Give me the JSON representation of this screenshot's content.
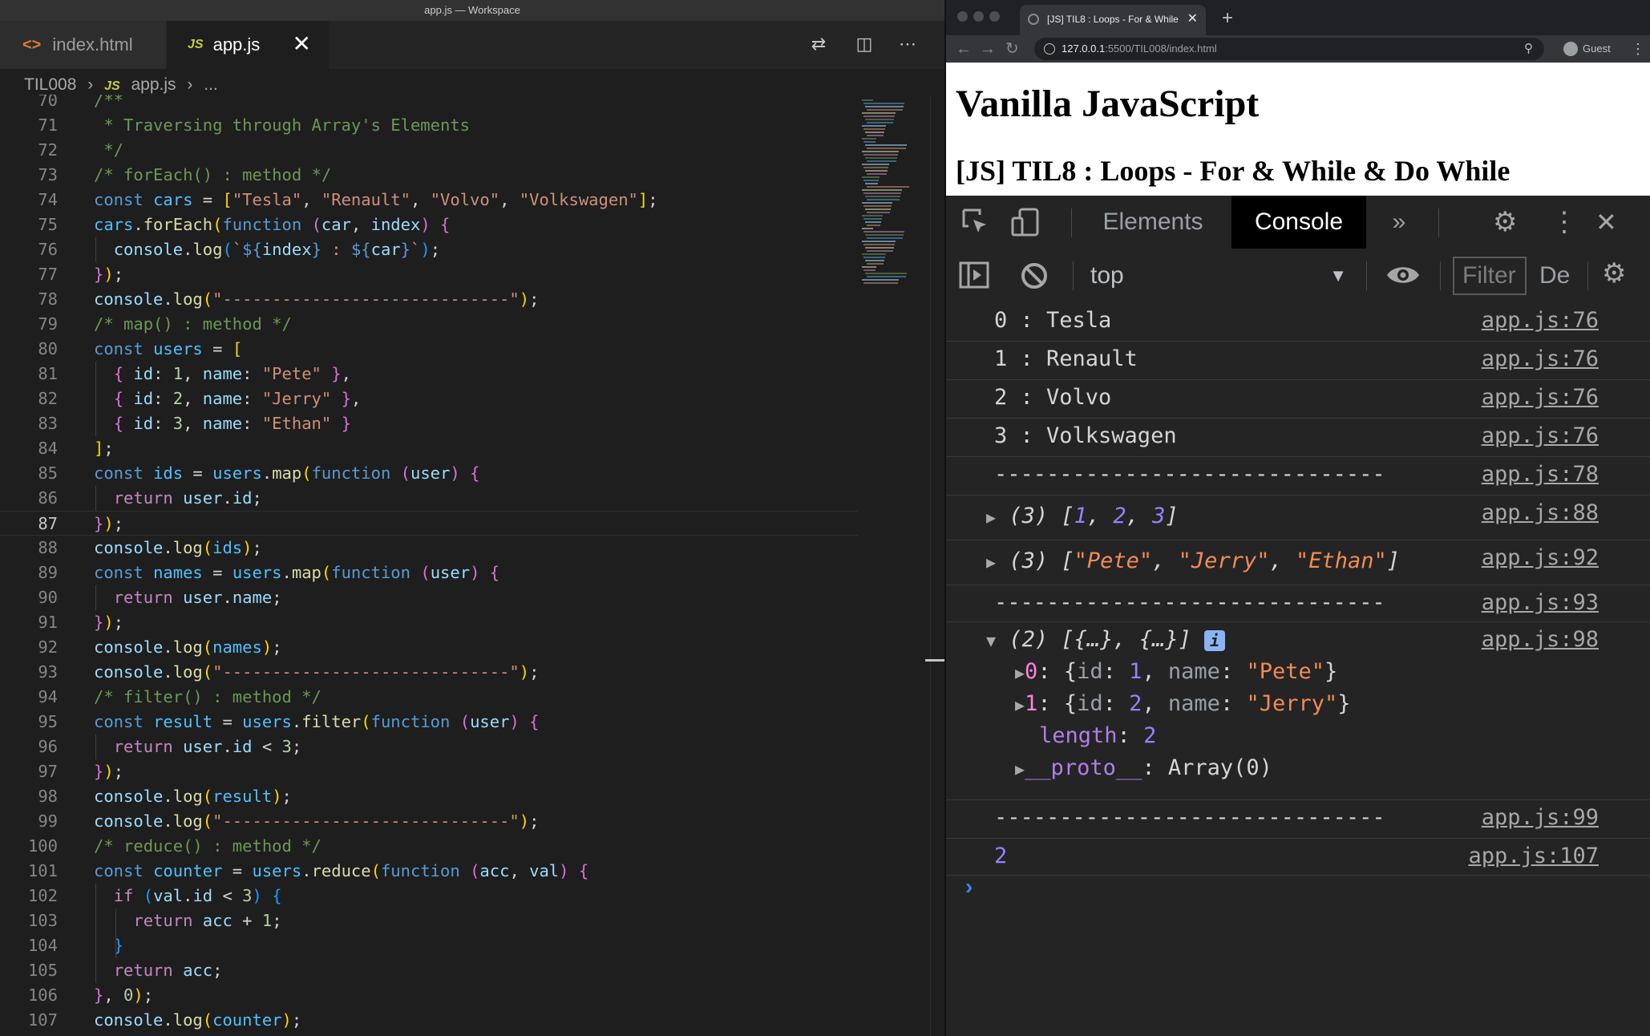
{
  "vscode": {
    "window_title": "app.js — Workspace",
    "tabs": [
      {
        "label": "index.html",
        "icon": "html-file-icon"
      },
      {
        "label": "app.js",
        "icon": "js-file-icon"
      }
    ],
    "tab_close_glyph": "✕",
    "breadcrumb": [
      "TIL008",
      "›",
      "JS",
      "app.js",
      "›",
      "..."
    ],
    "lines": [
      {
        "n": "70",
        "text": "/**"
      },
      {
        "n": "71",
        "text": " * Traversing through Array's Elements"
      },
      {
        "n": "72",
        "text": " */"
      },
      {
        "n": "73",
        "text": "/* forEach() : method */"
      },
      {
        "n": "74",
        "text": "const cars = [\"Tesla\", \"Renault\", \"Volvo\", \"Volkswagen\"];"
      },
      {
        "n": "75",
        "text": "cars.forEach(function (car, index) {"
      },
      {
        "n": "76",
        "text": "  console.log(`${index} : ${car}`);"
      },
      {
        "n": "77",
        "text": "});"
      },
      {
        "n": "78",
        "text": "console.log(\"-----------------------------\");"
      },
      {
        "n": "79",
        "text": "/* map() : method */"
      },
      {
        "n": "80",
        "text": "const users = ["
      },
      {
        "n": "81",
        "text": "  { id: 1, name: \"Pete\" },"
      },
      {
        "n": "82",
        "text": "  { id: 2, name: \"Jerry\" },"
      },
      {
        "n": "83",
        "text": "  { id: 3, name: \"Ethan\" }"
      },
      {
        "n": "84",
        "text": "];"
      },
      {
        "n": "85",
        "text": "const ids = users.map(function (user) {"
      },
      {
        "n": "86",
        "text": "  return user.id;"
      },
      {
        "n": "87",
        "text": "});"
      },
      {
        "n": "88",
        "text": "console.log(ids);"
      },
      {
        "n": "89",
        "text": "const names = users.map(function (user) {"
      },
      {
        "n": "90",
        "text": "  return user.name;"
      },
      {
        "n": "91",
        "text": "});"
      },
      {
        "n": "92",
        "text": "console.log(names);"
      },
      {
        "n": "93",
        "text": "console.log(\"-----------------------------\");"
      },
      {
        "n": "94",
        "text": "/* filter() : method */"
      },
      {
        "n": "95",
        "text": "const result = users.filter(function (user) {"
      },
      {
        "n": "96",
        "text": "  return user.id < 3;"
      },
      {
        "n": "97",
        "text": "});"
      },
      {
        "n": "98",
        "text": "console.log(result);"
      },
      {
        "n": "99",
        "text": "console.log(\"-----------------------------\");"
      },
      {
        "n": "100",
        "text": "/* reduce() : method */"
      },
      {
        "n": "101",
        "text": "const counter = users.reduce(function (acc, val) {"
      },
      {
        "n": "102",
        "text": "  if (val.id < 3) {"
      },
      {
        "n": "103",
        "text": "    return acc + 1;"
      },
      {
        "n": "104",
        "text": "  }"
      },
      {
        "n": "105",
        "text": "  return acc;"
      },
      {
        "n": "106",
        "text": "}, 0);"
      },
      {
        "n": "107",
        "text": "console.log(counter);"
      }
    ]
  },
  "chrome": {
    "tab_title": "[JS] TIL8 : Loops - For & While",
    "tab_close_glyph": "✕",
    "new_tab_glyph": "+",
    "url_host": "127.0.0.1",
    "url_path": ":5500/TIL008/index.html",
    "profile": "Guest",
    "page": {
      "h1": "Vanilla JavaScript",
      "h2": "[JS] TIL8 : Loops - For & While & Do While"
    },
    "devtools": {
      "tabs": [
        "Elements",
        "Console",
        "»"
      ],
      "context": "top",
      "filter_placeholder": "Filter",
      "levels": "De",
      "close_glyph": "✕"
    },
    "console": {
      "separator": "------------------------------",
      "messages": [
        {
          "text": "0 : Tesla",
          "source": "app.js:76"
        },
        {
          "text": "1 : Renault",
          "source": "app.js:76"
        },
        {
          "text": "2 : Volvo",
          "source": "app.js:76"
        },
        {
          "text": "3 : Volkswagen",
          "source": "app.js:76"
        },
        {
          "source": "app.js:78"
        },
        {
          "source": "app.js:88"
        },
        {
          "source": "app.js:92"
        },
        {
          "source": "app.js:93"
        },
        {
          "source": "app.js:98"
        },
        {
          "source": "app.js:99"
        },
        {
          "text": "2",
          "source": "app.js:107"
        }
      ],
      "ids_array": {
        "count": "(3)",
        "values": [
          "1",
          "2",
          "3"
        ]
      },
      "names_array": {
        "count": "(3)",
        "values": [
          "\"Pete\"",
          "\"Jerry\"",
          "\"Ethan\""
        ]
      },
      "result_array": {
        "count": "(2)",
        "summary": "[{…}, {…}]",
        "items": [
          {
            "index": "0",
            "id": "1",
            "name": "\"Pete\""
          },
          {
            "index": "1",
            "id": "2",
            "name": "\"Jerry\""
          }
        ],
        "length_key": "length",
        "length_value": "2",
        "proto_key": "__proto__",
        "proto_value": "Array(0)"
      }
    }
  }
}
